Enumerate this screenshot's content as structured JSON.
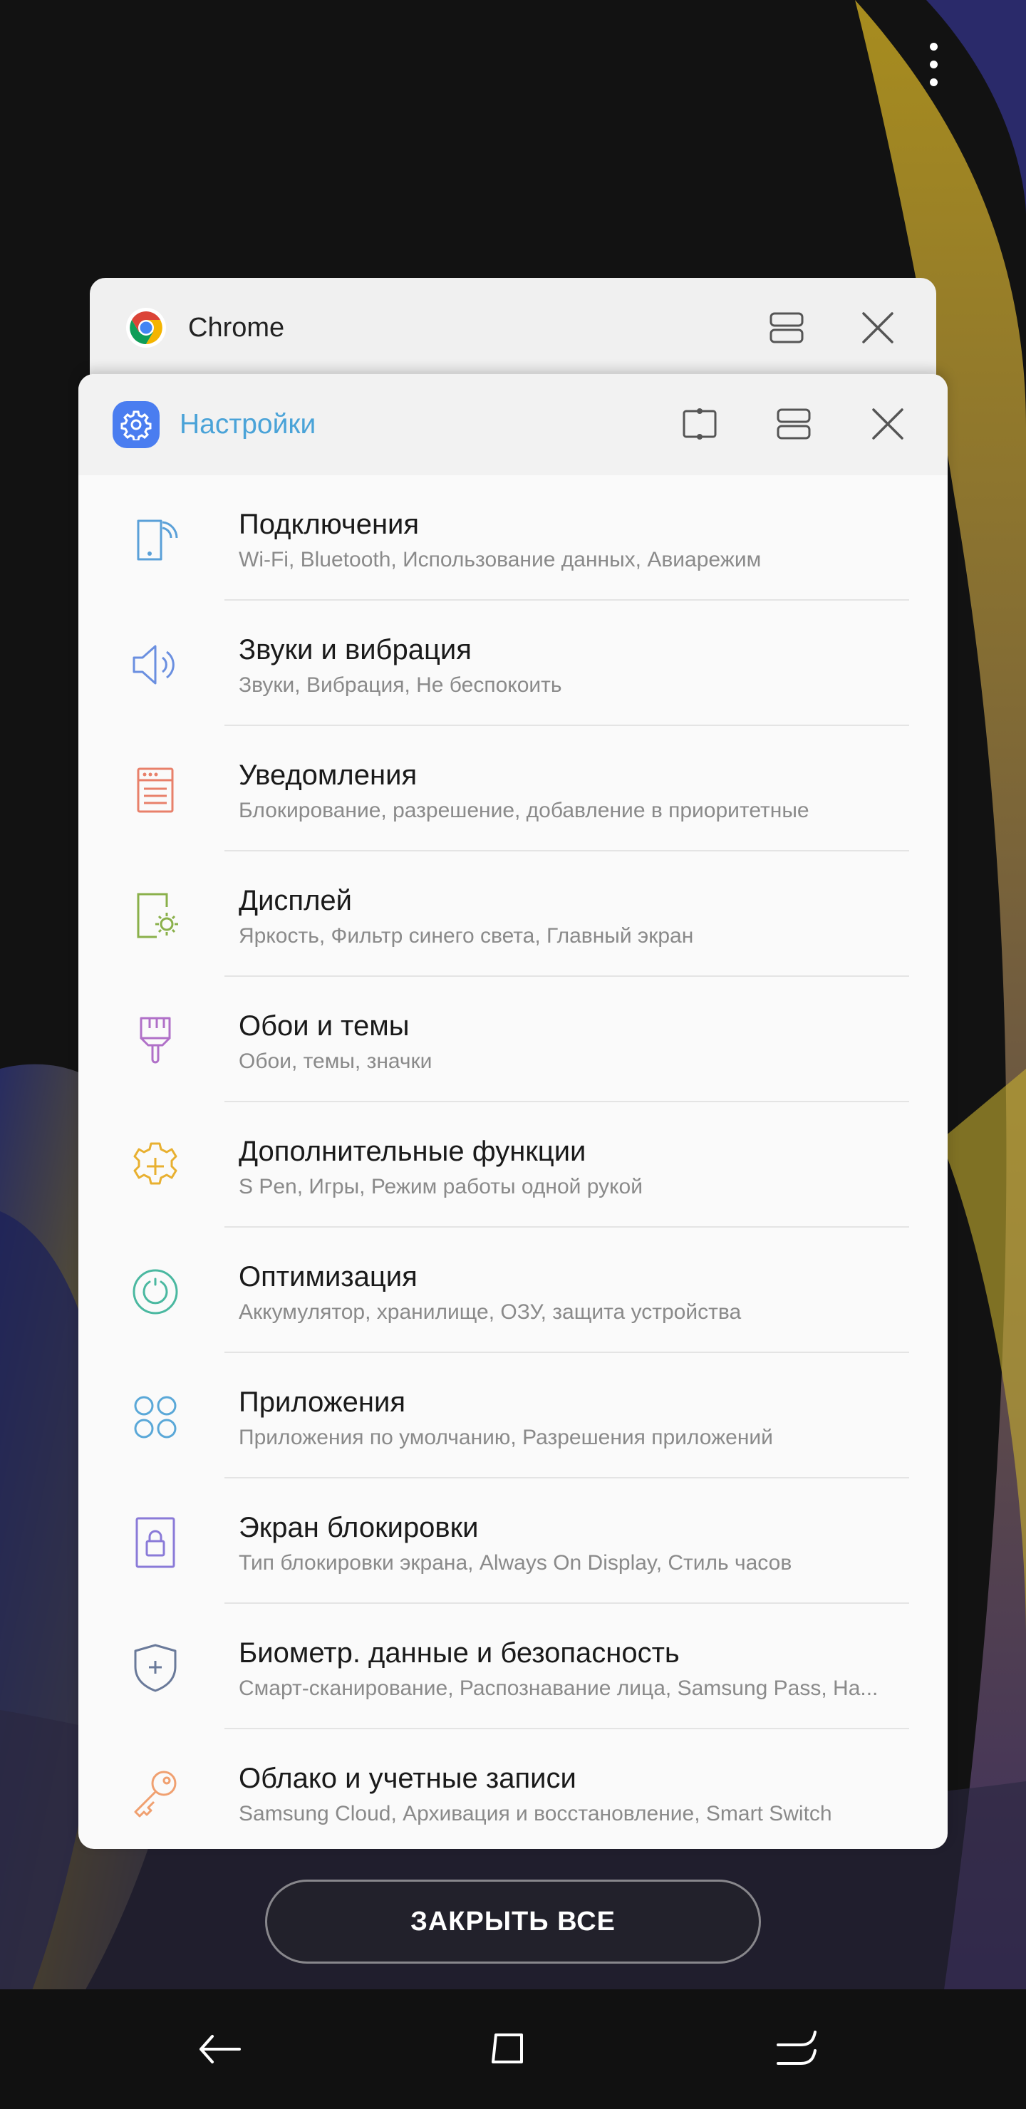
{
  "status": {
    "menu_icon": "more-vertical-icon"
  },
  "colors": {
    "accent_blue": "#4aa3d8",
    "settings_icon_bg": "#4a7df0",
    "background": "#121212"
  },
  "chrome_card": {
    "title": "Chrome",
    "icon": "chrome-logo-icon",
    "buttons": [
      "split-screen-icon",
      "close-icon"
    ]
  },
  "settings_card": {
    "title": "Настройки",
    "icon": "gear-icon",
    "buttons": [
      "pop-up-view-icon",
      "split-screen-icon",
      "close-icon"
    ],
    "items": [
      {
        "title": "Подключения",
        "subtitle": "Wi-Fi, Bluetooth, Использование данных, Авиарежим",
        "icon": "connections-icon",
        "color": "#5aa0d8"
      },
      {
        "title": "Звуки и вибрация",
        "subtitle": "Звуки, Вибрация, Не беспокоить",
        "icon": "speaker-icon",
        "color": "#6a8fe0"
      },
      {
        "title": "Уведомления",
        "subtitle": "Блокирование, разрешение, добавление в приоритетные",
        "icon": "notifications-icon",
        "color": "#e8806a"
      },
      {
        "title": "Дисплей",
        "subtitle": "Яркость, Фильтр синего света, Главный экран",
        "icon": "display-icon",
        "color": "#8ab04a"
      },
      {
        "title": "Обои и темы",
        "subtitle": "Обои, темы, значки",
        "icon": "brush-icon",
        "color": "#b070c8"
      },
      {
        "title": "Дополнительные функции",
        "subtitle": "S Pen, Игры, Режим работы одной рукой",
        "icon": "advanced-features-icon",
        "color": "#e8b030"
      },
      {
        "title": "Оптимизация",
        "subtitle": "Аккумулятор, хранилище, ОЗУ, защита устройства",
        "icon": "optimization-icon",
        "color": "#4ab8a0"
      },
      {
        "title": "Приложения",
        "subtitle": "Приложения по умолчанию, Разрешения приложений",
        "icon": "apps-icon",
        "color": "#5aa8d8"
      },
      {
        "title": "Экран блокировки",
        "subtitle": "Тип блокировки экрана, Always On Display, Стиль часов",
        "icon": "lock-icon",
        "color": "#8a7ad8"
      },
      {
        "title": "Биометр. данные и безопасность",
        "subtitle": "Смарт-сканирование, Распознавание лица, Samsung Pass, Ha...",
        "icon": "shield-icon",
        "color": "#6a7a9a"
      },
      {
        "title": "Облако и учетные записи",
        "subtitle": "Samsung Cloud, Архивация и восстановление, Smart Switch",
        "icon": "key-icon",
        "color": "#f0a070"
      }
    ]
  },
  "close_all": {
    "label": "ЗАКРЫТЬ ВСЕ"
  },
  "navbar": {
    "buttons": [
      "back-icon",
      "home-icon",
      "recents-icon"
    ]
  }
}
